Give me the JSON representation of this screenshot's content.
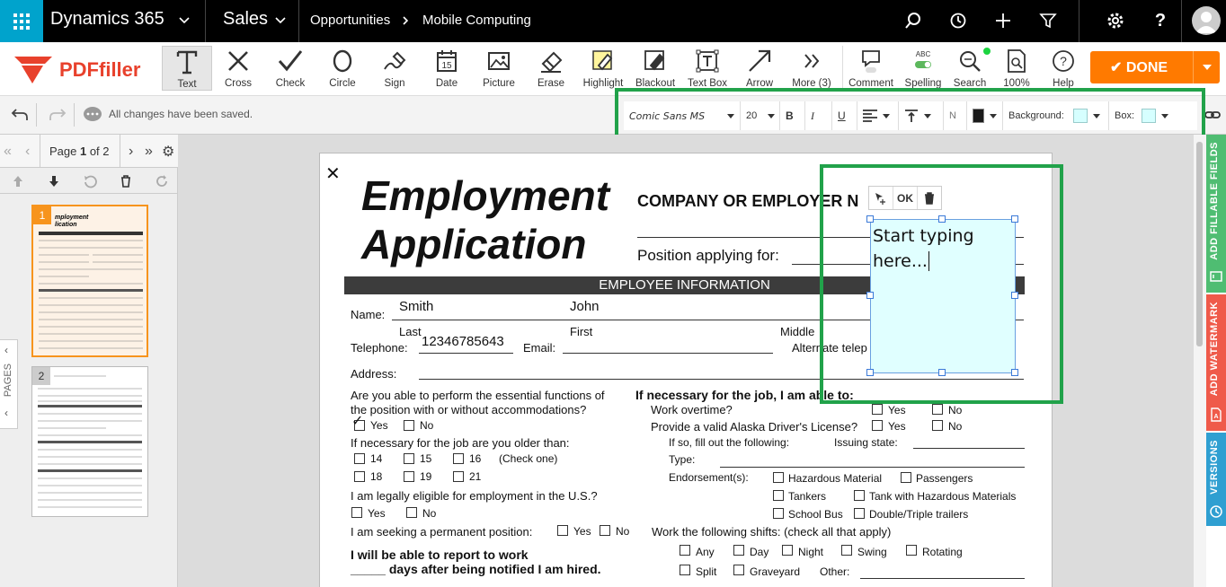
{
  "nav": {
    "app": "Dynamics 365",
    "area": "Sales",
    "crumbs": [
      "Opportunities",
      "Mobile Computing"
    ]
  },
  "toolbar": {
    "logo": "PDFfiller",
    "tools": [
      "Text",
      "Cross",
      "Check",
      "Circle",
      "Sign",
      "Date",
      "Picture",
      "Erase",
      "Highlight",
      "Blackout",
      "Text Box",
      "Arrow",
      "More (3)",
      "Comment",
      "Spelling",
      "Search",
      "100%",
      "Help"
    ],
    "spelling_badge": "ABC",
    "date_day": "15",
    "done": "DONE"
  },
  "subbar": {
    "status": "All changes have been saved."
  },
  "format": {
    "font": "Comic Sans MS",
    "size": "20",
    "bold": "B",
    "italic": "I",
    "underline": "U",
    "n": "N",
    "background_label": "Background:",
    "box_label": "Box:",
    "color": "#1a1a1a",
    "bg_color": "#d6ffff",
    "box_color": "#d6ffff"
  },
  "pages": {
    "label_pre": "Page ",
    "current": "1",
    "label_post": " of 2",
    "thumb1": "1",
    "thumb2": "2",
    "tab": "PAGES"
  },
  "doc": {
    "title1": "Employment",
    "title2": "Application",
    "company": "COMPANY OR EMPLOYER N",
    "position": "Position applying for:",
    "section": "EMPLOYEE INFORMATION",
    "name_label": "Name:",
    "last_val": "Smith",
    "first_val": "John",
    "last": "Last",
    "first": "First",
    "middle": "Middle",
    "tel_label": "Telephone:",
    "tel_val": "12346785643",
    "email_label": "Email:",
    "alt_tel": "Alternate telep",
    "address": "Address:",
    "q1a": "Are you able to perform the essential functions of",
    "q1b": "the position with or without accommodations?",
    "yes": "Yes",
    "no": "No",
    "q2": "If necessary for the job are you older than:",
    "age14": "14",
    "age15": "15",
    "age16": "16",
    "checkone": "(Check one)",
    "age18": "18",
    "age19": "19",
    "age21": "21",
    "q3": "I am legally eligible for employment in the U.S.?",
    "q4": "I am seeking a permanent position:",
    "q5a": "I will be able to report to work",
    "q5b": "_____ days after being notified I am hired.",
    "r_head": "If necessary for the job, I am able to:",
    "overtime": "Work overtime?",
    "license": "Provide a valid Alaska Driver's License?",
    "iffill": "If so, fill out the following:",
    "issuing": "Issuing state:",
    "type": "Type:",
    "endorse": "Endorsement(s):",
    "hazmat": "Hazardous Material",
    "passengers": "Passengers",
    "tankers": "Tankers",
    "tankhaz": "Tank with Hazardous Materials",
    "schoolbus": "School Bus",
    "double": "Double/Triple trailers",
    "shifts": "Work the following shifts: (check all that apply)",
    "any": "Any",
    "day": "Day",
    "night": "Night",
    "swing": "Swing",
    "rotating": "Rotating",
    "split": "Split",
    "graveyard": "Graveyard",
    "other": "Other:"
  },
  "textbox": {
    "text1": "Start typing",
    "text2": "here...",
    "ok": "OK"
  },
  "sidetabs": [
    "ADD FILLABLE FIELDS",
    "ADD WATERMARK",
    "VERSIONS"
  ]
}
